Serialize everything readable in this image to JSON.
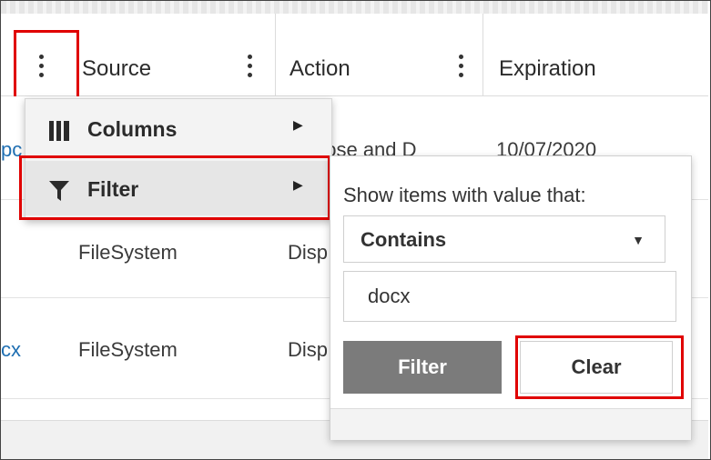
{
  "grid": {
    "columns": [
      {
        "label": "Source"
      },
      {
        "label": "Action"
      },
      {
        "label": "Expiration"
      }
    ],
    "rows": [
      {
        "name_fragment": "pc",
        "source": "",
        "action": "pose and D",
        "expiration": "10/07/2020"
      },
      {
        "name_fragment": "",
        "source": "FileSystem",
        "action": "Disp",
        "expiration": ""
      },
      {
        "name_fragment": "cx",
        "source": "FileSystem",
        "action": "Disp",
        "expiration": ""
      }
    ]
  },
  "column_menu": {
    "items": [
      {
        "label": "Columns",
        "icon": "columns-icon"
      },
      {
        "label": "Filter",
        "icon": "filter-icon"
      }
    ]
  },
  "filter_panel": {
    "caption": "Show items with value that:",
    "operator": "Contains",
    "value": "docx",
    "filter_label": "Filter",
    "clear_label": "Clear"
  },
  "colors": {
    "highlight": "#e00000",
    "link": "#1f6fb2",
    "filter_button": "#7b7b7b"
  }
}
